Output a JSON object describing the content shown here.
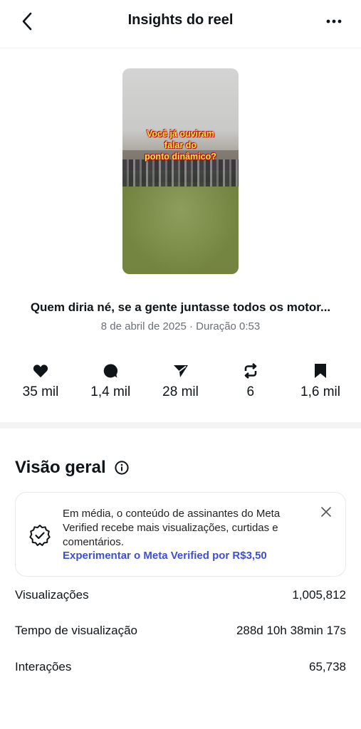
{
  "header": {
    "title": "Insights do reel"
  },
  "reel": {
    "overlay_line1": "Você já ouviram",
    "overlay_line2": "falar do",
    "overlay_line3": "ponto dinâmico?",
    "caption": "Quem diria né, se a gente juntasse todos os motor...",
    "meta": "8 de abril de 2025 · Duração 0:53"
  },
  "stats": [
    {
      "icon": "heart-icon",
      "value": "35 mil"
    },
    {
      "icon": "comment-icon",
      "value": "1,4 mil"
    },
    {
      "icon": "send-icon",
      "value": "28 mil"
    },
    {
      "icon": "repost-icon",
      "value": "6"
    },
    {
      "icon": "bookmark-icon",
      "value": "1,6 mil"
    }
  ],
  "overview": {
    "title": "Visão geral",
    "card_text": "Em média, o conteúdo de assinantes do Meta Verified recebe mais visualizações, curtidas e comentários.",
    "card_link": "Experimentar o Meta Verified por R$3,50",
    "rows": [
      {
        "label": "Visualizações",
        "value": "1,005,812"
      },
      {
        "label": "Tempo de visualização",
        "value": "288d 10h 38min 17s"
      },
      {
        "label": "Interações",
        "value": "65,738"
      }
    ]
  },
  "colors": {
    "link": "#3d4fd3",
    "text": "#0f1419",
    "muted": "#6b6f74"
  }
}
